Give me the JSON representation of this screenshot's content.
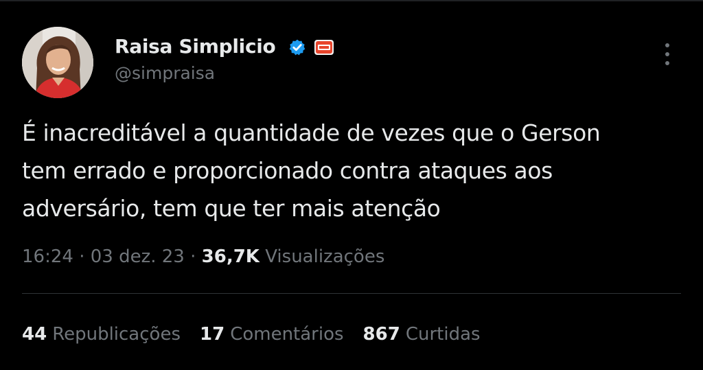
{
  "author": {
    "display_name": "Raisa Simplicio",
    "handle": "@simpraisa",
    "avatar_icon": "profile-photo",
    "verified_icon": "verified-badge-icon",
    "affiliate_icon": "goal-affiliate-badge-icon"
  },
  "tweet": {
    "lines": [
      "É inacreditável a quantidade de vezes que o Gerson",
      "tem errado e proporcionado contra ataques aos",
      "adversário, tem que ter mais atenção"
    ]
  },
  "meta": {
    "time": "16:24",
    "separator": "·",
    "date": "03 dez. 23",
    "views_count": "36,7K",
    "views_label": "Visualizações"
  },
  "stats": [
    {
      "count": "44",
      "label": "Republicações"
    },
    {
      "count": "17",
      "label": "Comentários"
    },
    {
      "count": "867",
      "label": "Curtidas"
    }
  ],
  "colors": {
    "background": "#000000",
    "text_primary": "#e7e9ea",
    "text_secondary": "#71767b",
    "verified_blue": "#1d9bf0",
    "divider": "#2f3336"
  }
}
